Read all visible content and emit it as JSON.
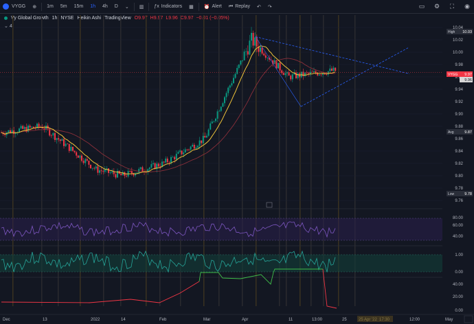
{
  "toolbar": {
    "symbol": "VYGG",
    "timeframes": [
      "1m",
      "5m",
      "15m",
      "1h",
      "4h",
      "D"
    ],
    "active_timeframe": "1h",
    "indicators_label": "Indicators",
    "alert_label": "Alert",
    "replay_label": "Replay"
  },
  "legend": {
    "name": "Vy Global Growth",
    "interval": "1h",
    "exchange": "NYSE",
    "chart_style": "Heikin Ashi",
    "source": "TradingView",
    "ohlc": {
      "o": "O9.97",
      "h": "H9.97",
      "l": "L9.96",
      "c": "C9.97",
      "chg": "−0.01 (−0.05%)"
    },
    "collapse": "4"
  },
  "price_axis": {
    "ticks": [
      "10.04",
      "10.02",
      "10.00",
      "9.98",
      "9.96",
      "9.94",
      "9.92",
      "9.90",
      "9.88",
      "9.86",
      "9.84",
      "9.82",
      "9.80",
      "9.78",
      "9.76"
    ],
    "high_label": "High",
    "high_value": "10.03",
    "symbol_tag": "VYGG",
    "last_price": "9.97",
    "last_price2": "9.96",
    "avg_label": "Avg",
    "avg_value": "9.87",
    "low_label": "Low",
    "low_value": "9.78"
  },
  "rsi_axis": [
    "80.00",
    "60.00",
    "40.00"
  ],
  "osc_axis": [
    "1.00",
    "0.00"
  ],
  "vol_axis": [
    "40.00",
    "20.00",
    "0.00"
  ],
  "time_axis": {
    "labels": [
      "Dec",
      "13",
      "2022",
      "14",
      "Feb",
      "Mar",
      "Apr",
      "11",
      "13:00",
      "25",
      "12:00",
      "May"
    ],
    "highlight_date": "25 Apr '22",
    "highlight_time": "17:30"
  },
  "colors": {
    "background": "#131722",
    "up": "#089981",
    "down": "#f23645",
    "sma_fast": "#f0c43a",
    "sma_slow": "#8a2f3a",
    "rsi": "#7e57c2",
    "osc": "#26a69a",
    "trendline": "#2962ff"
  },
  "chart_data": {
    "type": "candlestick",
    "chart_style": "Heikin Ashi",
    "symbol": "VYGG",
    "interval": "1h",
    "y_range": [
      9.76,
      10.04
    ],
    "key_levels": {
      "high": 10.03,
      "last": 9.97,
      "avg": 9.87,
      "low": 9.78
    },
    "price_path": [
      {
        "x": "Dec",
        "y": 9.87
      },
      {
        "x": "13",
        "y": 9.88
      },
      {
        "x": "2022",
        "y": 9.81
      },
      {
        "x": "14",
        "y": 9.8
      },
      {
        "x": "Feb",
        "y": 9.82
      },
      {
        "x": "Mar",
        "y": 9.86
      },
      {
        "x": "Apr",
        "y": 10.02
      },
      {
        "x": "11",
        "y": 9.96
      },
      {
        "x": "13:00",
        "y": 9.97
      }
    ],
    "indicators": {
      "rsi_range": [
        40,
        80
      ],
      "osc_range": [
        0,
        1
      ],
      "vol_range": [
        0,
        40
      ]
    }
  }
}
